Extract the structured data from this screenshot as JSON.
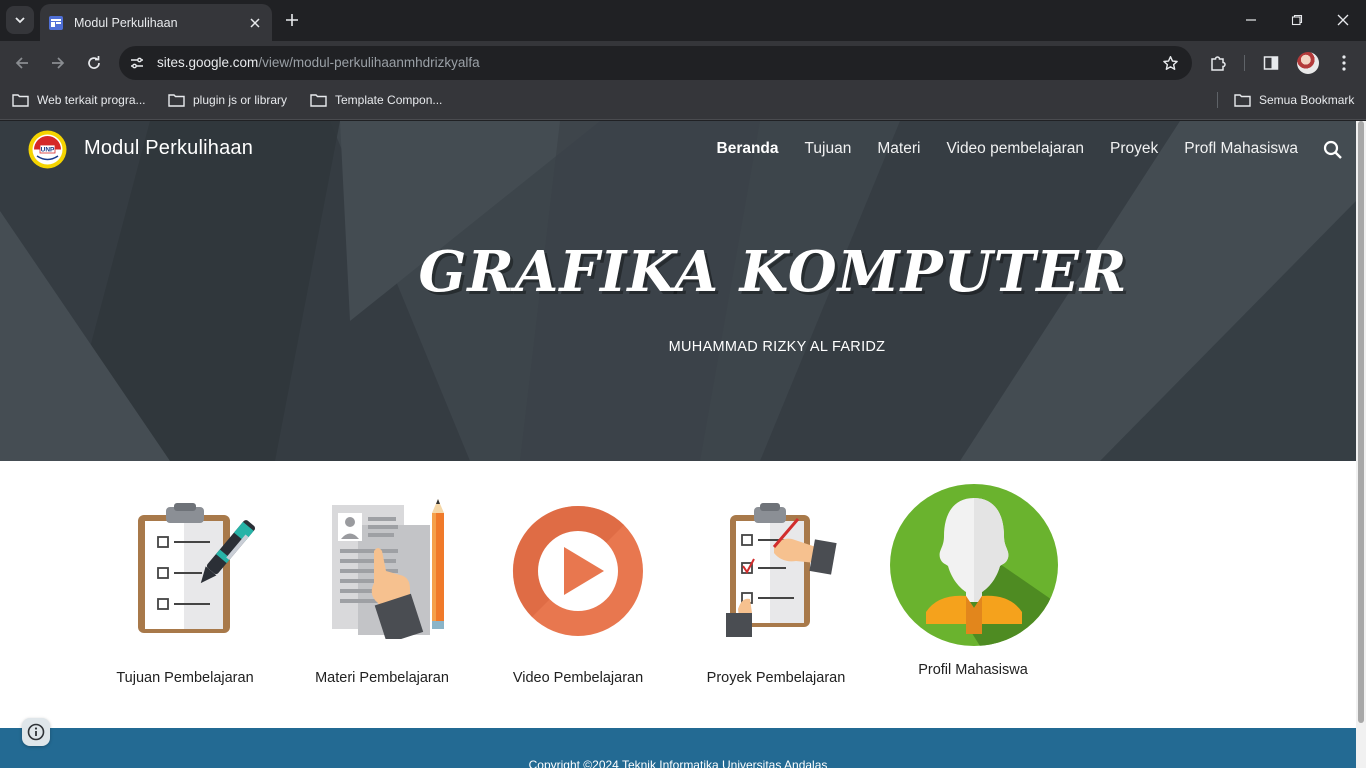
{
  "browser": {
    "tab_title": "Modul Perkulihaan",
    "url_host": "sites.google.com",
    "url_path": "/view/modul-perkulihaanmhdrizkyalfa",
    "bookmarks": [
      {
        "label": "Web terkait progra..."
      },
      {
        "label": "plugin js or library"
      },
      {
        "label": "Template Compon..."
      }
    ],
    "all_bookmarks_label": "Semua Bookmark"
  },
  "site": {
    "logo_text": "UNP",
    "title": "Modul Perkulihaan",
    "nav": [
      {
        "label": "Beranda",
        "active": true
      },
      {
        "label": "Tujuan"
      },
      {
        "label": "Materi"
      },
      {
        "label": "Video pembelajaran"
      },
      {
        "label": "Proyek"
      },
      {
        "label": "Profl Mahasiswa"
      }
    ]
  },
  "hero": {
    "title": "GRAFIKA KOMPUTER",
    "subtitle": "MUHAMMAD RIZKY AL FARIDZ"
  },
  "cards": [
    {
      "label": "Tujuan Pembelajaran",
      "icon": "clipboard-pen-icon"
    },
    {
      "label": "Materi Pembelajaran",
      "icon": "document-pencil-icon"
    },
    {
      "label": "Video Pembelajaran",
      "icon": "play-icon"
    },
    {
      "label": "Proyek Pembelajaran",
      "icon": "clipboard-checklist-icon"
    },
    {
      "label": "Profil Mahasiswa",
      "icon": "user-avatar-icon"
    }
  ],
  "footer": {
    "text": "Copyright ©2024 Teknik Informatika Universitas Andalas"
  },
  "colors": {
    "hero_bg": "#3b4248",
    "footer_bg": "#236a93",
    "play_orange": "#e8774f",
    "avatar_green": "#6ab32e"
  }
}
